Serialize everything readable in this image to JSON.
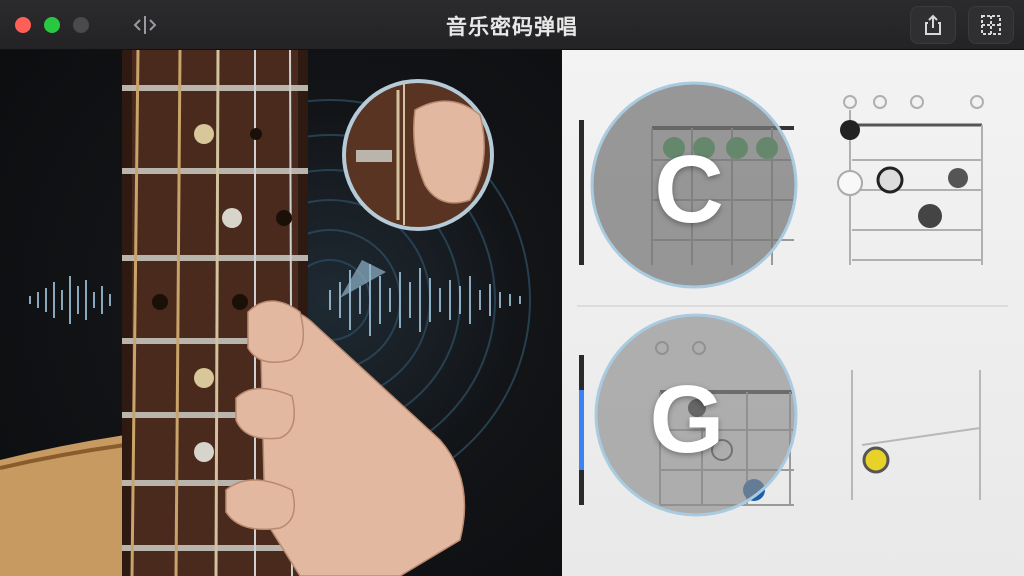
{
  "window": {
    "title": "音乐密码弹唱"
  },
  "toolbar": {
    "sidebar_toggle_icon": "sidebar-toggle-icon",
    "share_icon": "share-icon",
    "grid_icon": "grid-icon"
  },
  "chords": {
    "top": {
      "letter": "C"
    },
    "bottom": {
      "letter": "G"
    }
  },
  "colors": {
    "close": "#fe5f57",
    "minimize": "#28c840",
    "accent_blue": "#3b82f6",
    "green_dot": "#2db84b",
    "yellow_dot": "#e8d22a"
  }
}
